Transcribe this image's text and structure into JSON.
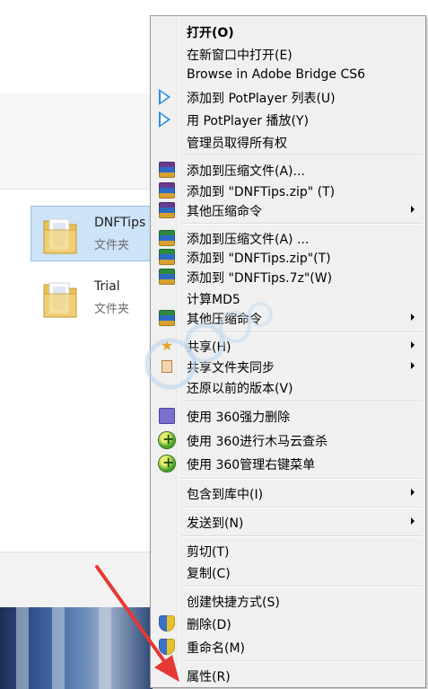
{
  "files": [
    {
      "name": "DNFTips",
      "type": "文件夹",
      "selected": true
    },
    {
      "name": "Trial",
      "type": "文件夹",
      "selected": false
    }
  ],
  "menu": {
    "items": [
      {
        "label": "打开(O)",
        "bold": true
      },
      {
        "label": "在新窗口中打开(E)"
      },
      {
        "label": "Browse in Adobe Bridge CS6"
      },
      {
        "label": "添加到 PotPlayer 列表(U)",
        "icon": "potplayer-play-icon"
      },
      {
        "label": "用 PotPlayer 播放(Y)",
        "icon": "potplayer-play-icon"
      },
      {
        "label": "管理员取得所有权"
      },
      {
        "label": "添加到压缩文件(A)...",
        "icon": "winrar-icon"
      },
      {
        "label": "添加到 \"DNFTips.zip\" (T)",
        "icon": "winrar-icon"
      },
      {
        "label": "其他压缩命令",
        "icon": "winrar-icon",
        "submenu": true
      },
      {
        "label": "添加到压缩文件(A) ...",
        "icon": "7zip-icon"
      },
      {
        "label": "添加到 \"DNFTips.zip\"(T)",
        "icon": "7zip-icon"
      },
      {
        "label": "添加到 \"DNFTips.7z\"(W)",
        "icon": "7zip-icon"
      },
      {
        "label": "计算MD5"
      },
      {
        "label": "其他压缩命令",
        "icon": "7zip-icon",
        "submenu": true
      },
      {
        "label": "共享(H)",
        "icon": "share-icon",
        "submenu": true
      },
      {
        "label": "共享文件夹同步",
        "icon": "sync-icon",
        "submenu": true
      },
      {
        "label": "还原以前的版本(V)"
      },
      {
        "label": "使用 360强力删除",
        "icon": "360-delete-icon"
      },
      {
        "label": "使用 360进行木马云查杀",
        "icon": "360-ball-icon"
      },
      {
        "label": "使用 360管理右键菜单",
        "icon": "360-ball-icon"
      },
      {
        "label": "包含到库中(I)",
        "submenu": true
      },
      {
        "label": "发送到(N)",
        "submenu": true
      },
      {
        "label": "剪切(T)"
      },
      {
        "label": "复制(C)"
      },
      {
        "label": "创建快捷方式(S)"
      },
      {
        "label": "删除(D)",
        "icon": "uac-shield-icon"
      },
      {
        "label": "重命名(M)",
        "icon": "uac-shield-icon"
      },
      {
        "label": "属性(R)"
      }
    ]
  },
  "colors": {
    "selection": "#cde3f8",
    "menu_background": "#f0f0f0",
    "annotation_arrow": "#e53935"
  }
}
